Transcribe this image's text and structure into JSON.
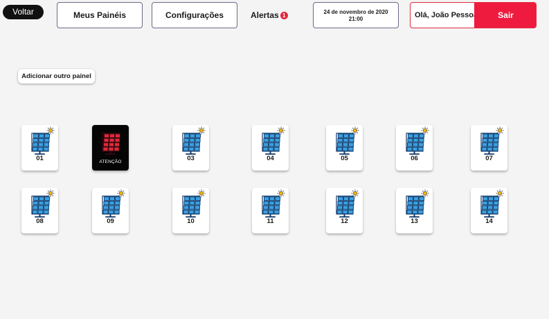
{
  "header": {
    "back_label": "Voltar",
    "my_panels_label": "Meus Painéis",
    "settings_label": "Configurações",
    "alerts_label": "Alertas",
    "alerts_count": "1",
    "date": "24 de novembro de 2020",
    "time": "21:00",
    "greeting": "Olá, João Pessoa",
    "logout_label": "Sair"
  },
  "add_panel_label": "Adicionar outro painel",
  "colors": {
    "accent_red": "#ee1b3e",
    "panel_blue": "#3aa0e0",
    "panel_alert_red": "#e0283c",
    "sun_yellow": "#f5b800"
  },
  "panels": [
    {
      "label": "01",
      "status": "normal"
    },
    {
      "label": "ATENÇÃO",
      "status": "warning"
    },
    {
      "label": "03",
      "status": "normal"
    },
    {
      "label": "04",
      "status": "normal"
    },
    {
      "label": "05",
      "status": "normal"
    },
    {
      "label": "06",
      "status": "normal"
    },
    {
      "label": "07",
      "status": "normal"
    },
    {
      "label": "08",
      "status": "normal"
    },
    {
      "label": "09",
      "status": "normal"
    },
    {
      "label": "10",
      "status": "normal"
    },
    {
      "label": "11",
      "status": "normal"
    },
    {
      "label": "12",
      "status": "normal"
    },
    {
      "label": "13",
      "status": "normal"
    },
    {
      "label": "14",
      "status": "normal"
    }
  ]
}
